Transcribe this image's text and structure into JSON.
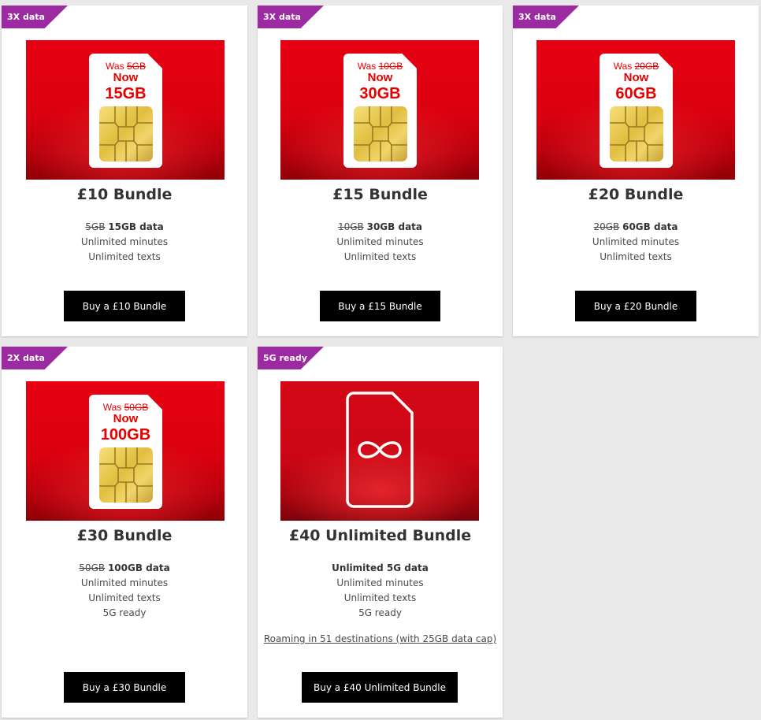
{
  "colors": {
    "page_background": "#e9e9e9",
    "card_background": "#ffffff",
    "ribbon": "#9c2aa0",
    "promo_red": "#e60012",
    "button": "#000000",
    "button_text": "#ffffff"
  },
  "cards": [
    {
      "ribbon": "3X data",
      "sim": {
        "was_label": "Was",
        "was_value": "5GB",
        "now_label": "Now",
        "amount": "15GB"
      },
      "title": "£10 Bundle",
      "data_old": "5GB",
      "data_new": "15GB data",
      "minutes": "Unlimited minutes",
      "texts": "Unlimited texts",
      "button": "Buy a £10 Bundle"
    },
    {
      "ribbon": "3X data",
      "sim": {
        "was_label": "Was",
        "was_value": "10GB",
        "now_label": "Now",
        "amount": "30GB"
      },
      "title": "£15 Bundle",
      "data_old": "10GB",
      "data_new": "30GB data",
      "minutes": "Unlimited minutes",
      "texts": "Unlimited texts",
      "button": "Buy a £15 Bundle"
    },
    {
      "ribbon": "3X data",
      "sim": {
        "was_label": "Was",
        "was_value": "20GB",
        "now_label": "Now",
        "amount": "60GB"
      },
      "title": "£20 Bundle",
      "data_old": "20GB",
      "data_new": "60GB data",
      "minutes": "Unlimited minutes",
      "texts": "Unlimited texts",
      "button": "Buy a £20 Bundle"
    },
    {
      "ribbon": "2X data",
      "sim": {
        "was_label": "Was",
        "was_value": "50GB",
        "now_label": "Now",
        "amount": "100GB"
      },
      "title": "£30 Bundle",
      "data_old": "50GB",
      "data_new": "100GB data",
      "minutes": "Unlimited minutes",
      "texts": "Unlimited texts",
      "extra": "5G ready",
      "button": "Buy a £30 Bundle"
    },
    {
      "ribbon": "5G ready",
      "sim_icon": "infinity-sim-icon",
      "title": "£40 Unlimited Bundle",
      "data_new": "Unlimited 5G data",
      "minutes": "Unlimited minutes",
      "texts": "Unlimited texts",
      "extra": "5G ready",
      "roaming_link": "Roaming in 51 destinations (with 25GB data cap)",
      "button": "Buy a £40 Unlimited Bundle"
    }
  ]
}
